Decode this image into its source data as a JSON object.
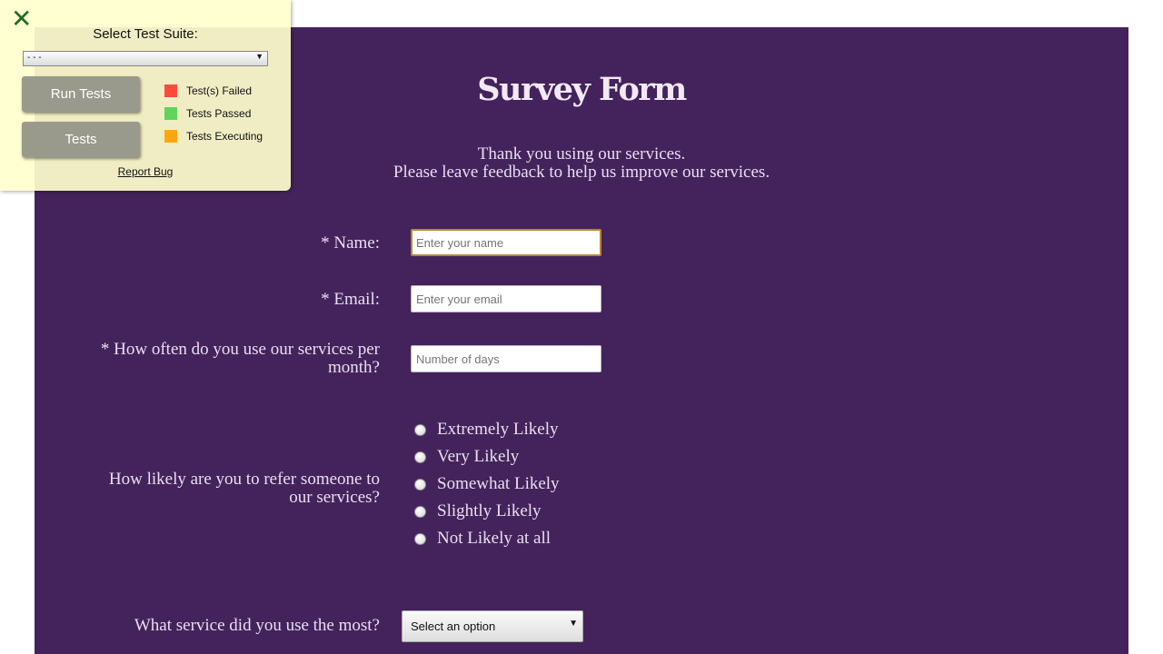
{
  "survey": {
    "title": "Survey Form",
    "description_line1": "Thank you using our services.",
    "description_line2": "Please leave feedback to help us improve our services.",
    "name_label": "* Name:",
    "name_placeholder": "Enter your name",
    "email_label": "* Email:",
    "email_placeholder": "Enter your email",
    "usage_label_line1": "* How often do you use our services per",
    "usage_label_line2": "month?",
    "usage_placeholder": "Number of days",
    "refer_label_line1": "How likely are you to refer someone to",
    "refer_label_line2": "our services?",
    "refer_options": [
      "Extremely Likely",
      "Very Likely",
      "Somewhat Likely",
      "Slightly Likely",
      "Not Likely at all"
    ],
    "service_label": "What service did you use the most?",
    "service_select_value": "Select an option"
  },
  "test_panel": {
    "heading": "Select Test Suite:",
    "suite_select_value": "- - -",
    "run_tests_label": "Run Tests",
    "tests_label": "Tests",
    "legend": [
      {
        "label": "Test(s) Failed",
        "color": "#ff4a3d"
      },
      {
        "label": "Tests Passed",
        "color": "#5fd35a"
      },
      {
        "label": "Tests Executing",
        "color": "#ffa514"
      }
    ],
    "report_bug_label": "Report Bug"
  }
}
